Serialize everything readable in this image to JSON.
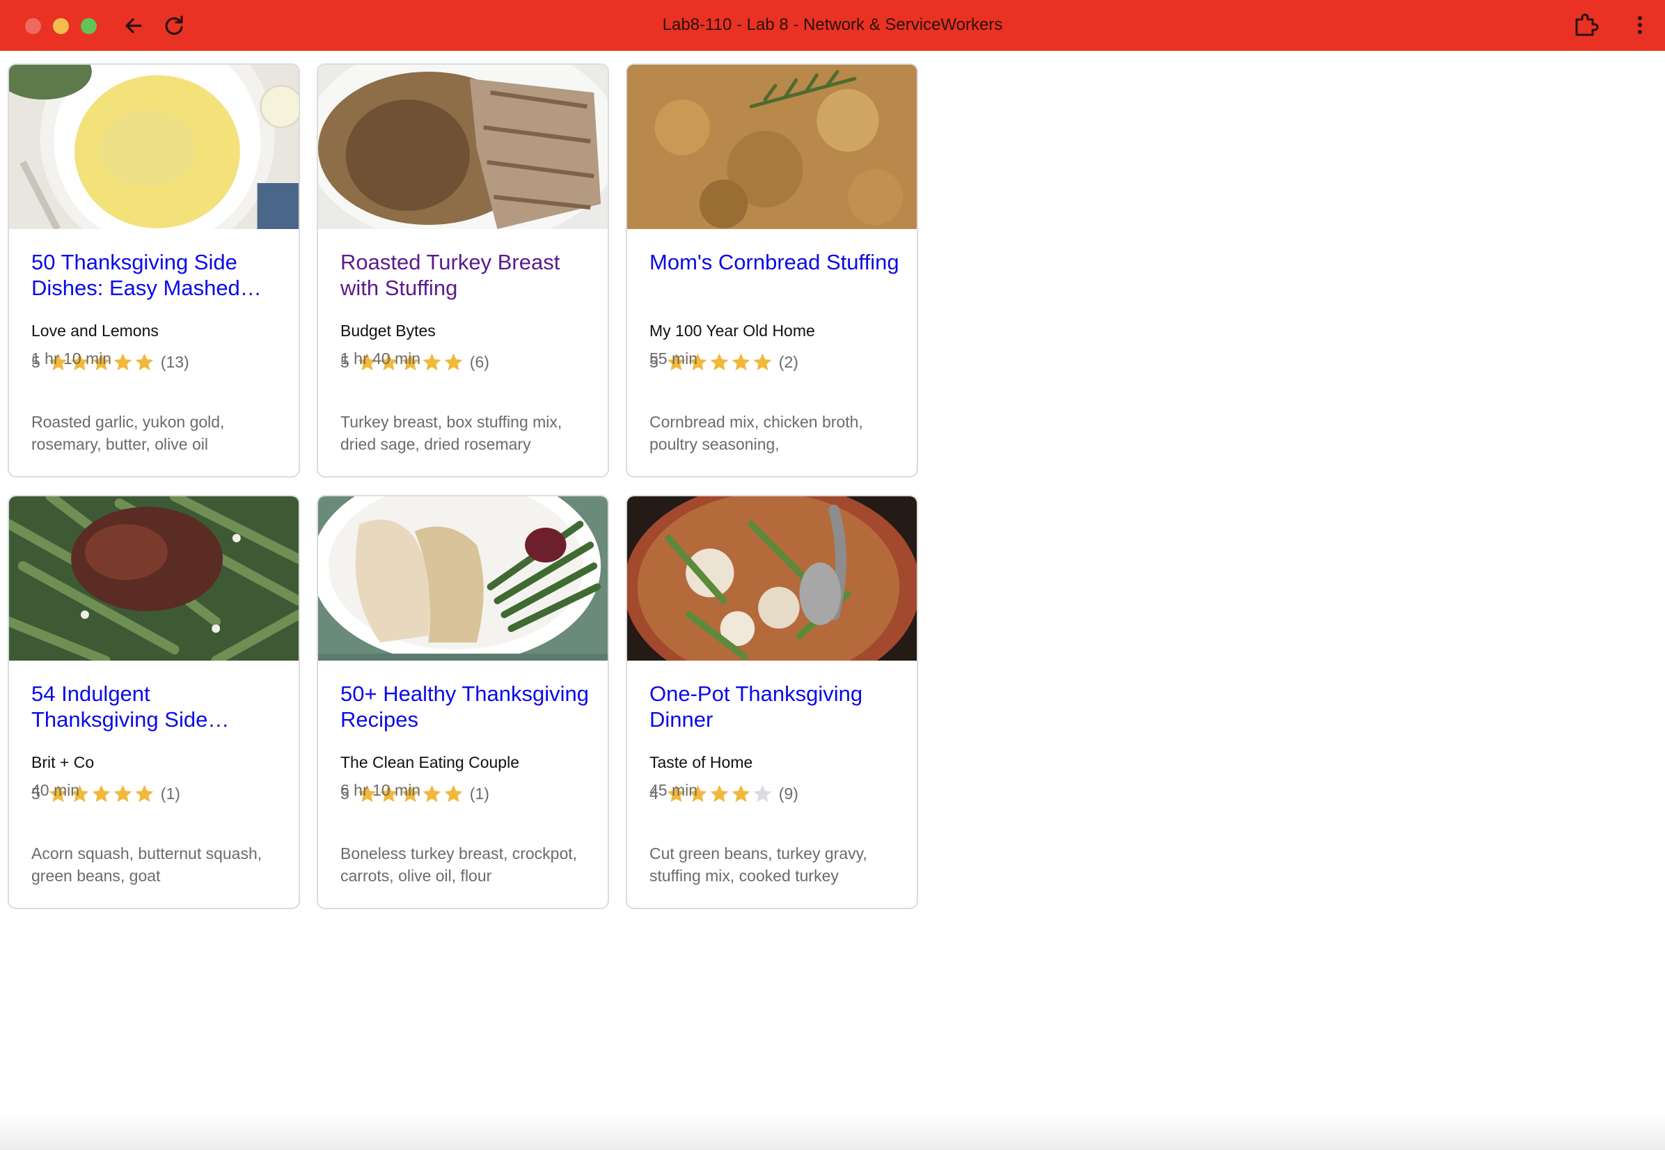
{
  "window": {
    "title": "Lab8-110 - Lab 8 - Network & ServiceWorkers",
    "colors": {
      "titlebar": "#e93223",
      "link": "#0a0ae8",
      "visited": "#5b1a8c",
      "star": "#f2b83b",
      "star_empty": "#dadce0"
    }
  },
  "recipes": [
    {
      "title": "50 Thanksgiving Side Dishes: Easy Mashed…",
      "source": "Love and Lemons",
      "rating": "5",
      "stars": 5,
      "count": "(13)",
      "time": "1 hr 10 min",
      "ingredients": "Roasted garlic, yukon gold, rosemary, butter, olive oil"
    },
    {
      "title": "Roasted Turkey Breast with Stuffing",
      "source": "Budget Bytes",
      "rating": "5",
      "stars": 5,
      "count": "(6)",
      "time": "1 hr 40 min",
      "ingredients": "Turkey breast, box stuffing mix, dried sage, dried rosemary"
    },
    {
      "title": "Mom's Cornbread Stuffing",
      "source": "My 100 Year Old Home",
      "rating": "5",
      "stars": 5,
      "count": "(2)",
      "time": "55 min",
      "ingredients": "Cornbread mix, chicken broth, poultry seasoning,"
    },
    {
      "title": "54 Indulgent Thanksgiving Side…",
      "source": "Brit + Co",
      "rating": "5",
      "stars": 5,
      "count": "(1)",
      "time": "40 min",
      "ingredients": "Acorn squash, butternut squash, green beans, goat"
    },
    {
      "title": "50+ Healthy Thanksgiving Recipes",
      "source": "The Clean Eating Couple",
      "rating": "5",
      "stars": 5,
      "count": "(1)",
      "time": "6 hr 10 min",
      "ingredients": "Boneless turkey breast, crockpot, carrots, olive oil, flour"
    },
    {
      "title": "One-Pot Thanksgiving Dinner",
      "source": "Taste of Home",
      "rating": "4",
      "stars": 4,
      "count": "(9)",
      "time": "45 min",
      "ingredients": "Cut green beans, turkey gravy, stuffing mix, cooked turkey"
    }
  ]
}
